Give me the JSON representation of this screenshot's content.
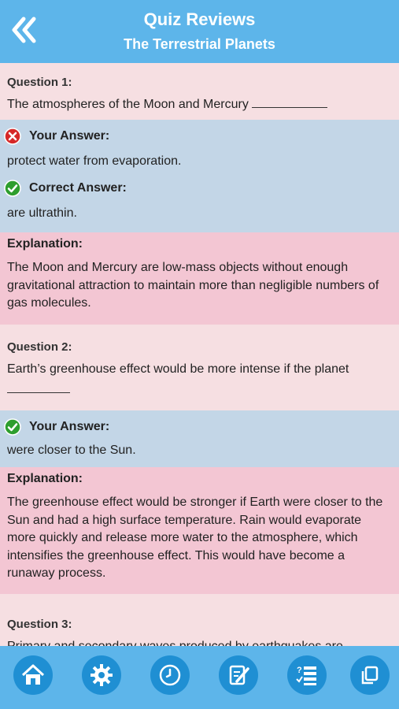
{
  "header": {
    "title": "Quiz Reviews",
    "subtitle": "The Terrestrial Planets"
  },
  "questions": [
    {
      "label": "Question 1:",
      "text": "The atmospheres of the Moon and Mercury",
      "your_answer_label": "Your Answer:",
      "your_answer": "protect water from evaporation.",
      "your_answer_status": "incorrect",
      "correct_answer_label": "Correct Answer:",
      "correct_answer": "are ultrathin.",
      "explanation_label": "Explanation:",
      "explanation": "The Moon and Mercury are low-mass objects without enough gravitational attraction to maintain more than negligible numbers of gas molecules."
    },
    {
      "label": "Question 2:",
      "text": "Earth’s greenhouse effect would be more intense if the planet",
      "your_answer_label": "Your Answer:",
      "your_answer": "were closer to the Sun.",
      "your_answer_status": "correct",
      "explanation_label": "Explanation:",
      "explanation": "The greenhouse effect would be stronger if Earth were closer to the Sun and had a high surface temperature. Rain would evaporate more quickly and release more water to the atmosphere, which intensifies the greenhouse effect. This would have become a runaway process."
    },
    {
      "label": "Question 3:",
      "text": "Primary and secondary waves produced by earthquakes are"
    }
  ],
  "toolbar": {
    "icons": [
      "home-icon",
      "settings-gear-icon",
      "clock-icon",
      "edit-notes-icon",
      "quiz-list-icon",
      "copy-icon"
    ]
  },
  "colors": {
    "header": "#5db5ea",
    "question_bg": "#f6dfe2",
    "answer_bg": "#c3d6e7",
    "explanation_bg": "#f3c6d3",
    "button": "#1f8fd3"
  }
}
